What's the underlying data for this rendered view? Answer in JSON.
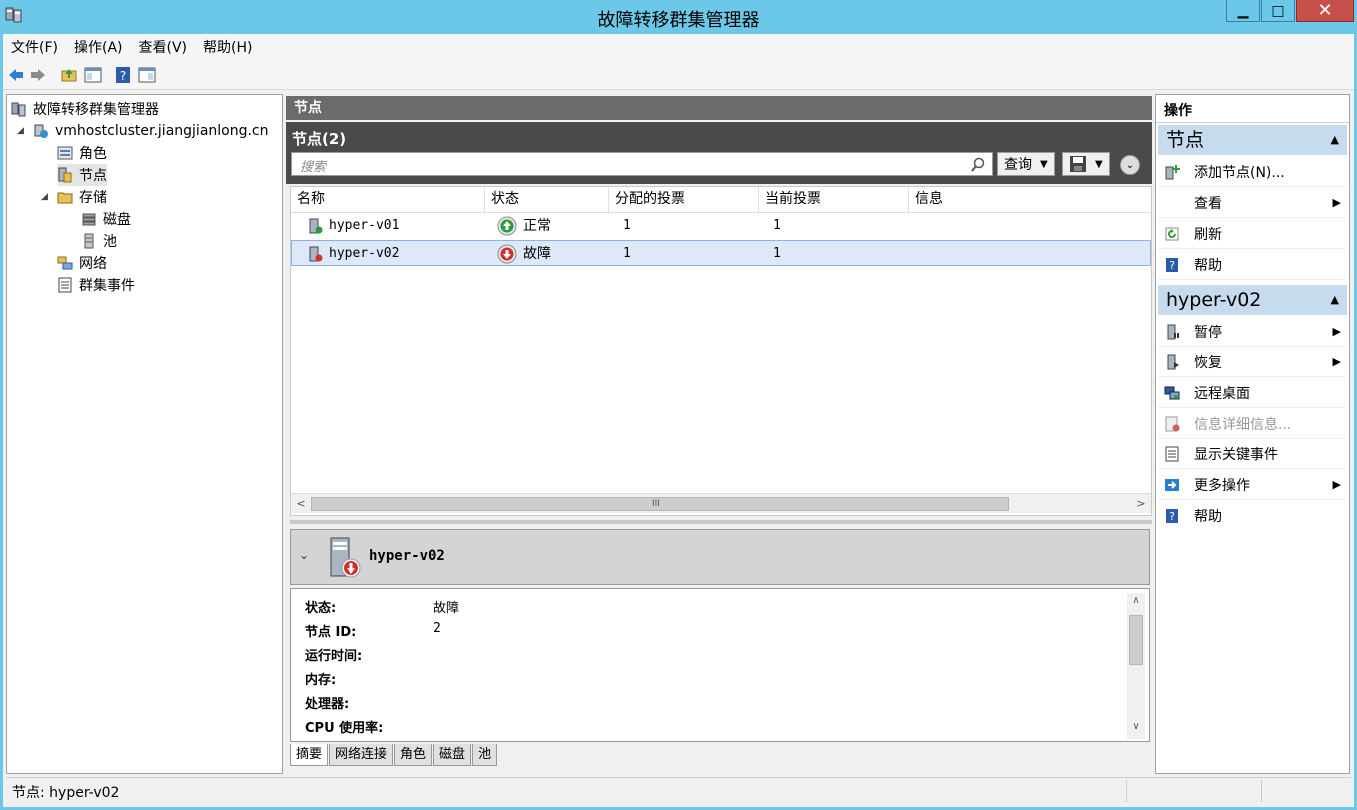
{
  "window": {
    "title": "故障转移群集管理器"
  },
  "menu": [
    "文件(F)",
    "操作(A)",
    "查看(V)",
    "帮助(H)"
  ],
  "tree": {
    "root": "故障转移群集管理器",
    "cluster": "vmhostcluster.jiangjianlong.cn",
    "items": {
      "roles": "角色",
      "nodes": "节点",
      "storage": "存储",
      "disks": "磁盘",
      "pools": "池",
      "networks": "网络",
      "events": "群集事件"
    }
  },
  "center": {
    "header": "节点",
    "panel_title": "节点(2)",
    "search_placeholder": "搜索",
    "query_label": "查询",
    "columns": [
      "名称",
      "状态",
      "分配的投票",
      "当前投票",
      "信息"
    ],
    "rows": [
      {
        "name": "hyper-v01",
        "status": "正常",
        "assigned_vote": "1",
        "current_vote": "1",
        "info": "",
        "status_color": "#2f9a3a"
      },
      {
        "name": "hyper-v02",
        "status": "故障",
        "assigned_vote": "1",
        "current_vote": "1",
        "info": "",
        "status_color": "#d03030"
      }
    ]
  },
  "detail": {
    "name": "hyper-v02",
    "fields": [
      {
        "key": "状态:",
        "value": "故障"
      },
      {
        "key": "节点 ID:",
        "value": "2"
      },
      {
        "key": "运行时间:",
        "value": ""
      },
      {
        "key": "内存:",
        "value": ""
      },
      {
        "key": "处理器:",
        "value": ""
      },
      {
        "key": "CPU 使用率:",
        "value": ""
      }
    ],
    "tabs": [
      "摘要",
      "网络连接",
      "角色",
      "磁盘",
      "池"
    ]
  },
  "actions": {
    "header": "操作",
    "section1": {
      "title": "节点",
      "items": [
        "添加节点(N)...",
        "查看",
        "刷新",
        "帮助"
      ]
    },
    "section2": {
      "title": "hyper-v02",
      "items": [
        "暂停",
        "恢复",
        "远程桌面",
        "信息详细信息...",
        "显示关键事件",
        "更多操作",
        "帮助"
      ]
    }
  },
  "statusbar": {
    "text": "节点:  hyper-v02"
  },
  "colors": {
    "titlebar": "#6cc8e8",
    "section": "#c7dbef",
    "selection": "#dde9f9",
    "close": "#c7504a"
  }
}
